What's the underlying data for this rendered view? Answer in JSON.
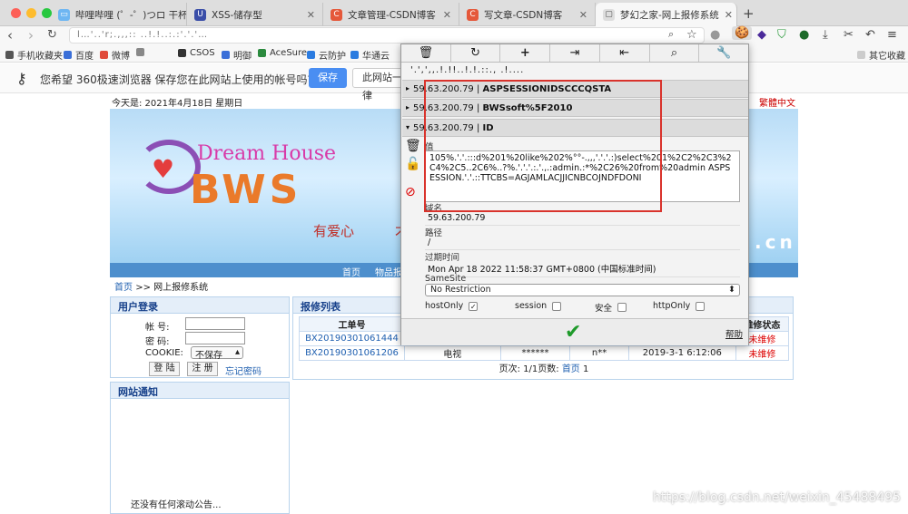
{
  "tabs": [
    {
      "title": "哔哩哔哩 (゜-゜)つロ 干杯~-…",
      "color": "#6eb6f2",
      "glyph": "▭"
    },
    {
      "title": "XSS-储存型",
      "color": "#3a4ea8",
      "glyph": "U"
    },
    {
      "title": "文章管理-CSDN博客",
      "color": "#e5583a",
      "glyph": "C"
    },
    {
      "title": "写文章-CSDN博客",
      "color": "#e5583a",
      "glyph": "C"
    },
    {
      "title": "梦幻之家-网上报修系统",
      "color": "#dddddd",
      "glyph": "▢"
    }
  ],
  "address": {
    "value": "l…'..'r;.,,,:: ..!.!..:.:'.'.'…"
  },
  "bookmarks": [
    {
      "label": "手机收藏夹",
      "color": "#555555"
    },
    {
      "label": "百度",
      "color": "#3a6fd8"
    },
    {
      "label": "微博",
      "color": "#e04a3a"
    },
    {
      "label": "",
      "color": "#888888"
    },
    {
      "label": "CSOS",
      "color": "#333333"
    },
    {
      "label": "明御",
      "color": "#3a6fd8"
    },
    {
      "label": "AceSure",
      "color": "#2b8a3e"
    },
    {
      "label": "云防护",
      "color": "#2a7be0"
    },
    {
      "label": "华通云",
      "color": "#2a7be0"
    }
  ],
  "bookmarks_other": "其它收藏",
  "notify": {
    "message": "您希望 360极速浏览器 保存您在此网站上使用的帐号吗?",
    "save": "保存",
    "deny": "此网站一律"
  },
  "site": {
    "date": "今天是: 2021年4月18日 星期日",
    "trad": "繁體中文",
    "logo_top": "Dream House",
    "logo_main": "BWS",
    "slogan": "有爱心",
    "slogan2": "才",
    "cn": ".cn",
    "menu": [
      "首页",
      "物品报"
    ],
    "crumb_home": "首页",
    "crumb_sep": ">>",
    "crumb_page": "网上报修系统",
    "login_title": "用户登录",
    "account_label": "帐  号:",
    "password_label": "密  码:",
    "cookie_label": "COOKIE:",
    "cookie_option": "不保存",
    "login_btn": "登 陆",
    "register_btn": "注 册",
    "forgot": "忘记密码",
    "notice_title": "网站通知",
    "notice_text": "还没有任何滚动公告...",
    "list_title": "报修列表",
    "table_headers": [
      "工单号",
      "维修状态"
    ],
    "rows": [
      {
        "id": "BX20190301061444",
        "item": "",
        "code": "",
        "user": "",
        "time": "",
        "status": "未维修"
      },
      {
        "id": "BX20190301061206",
        "item": "电视",
        "code": "******",
        "user": "n**",
        "time": "2019-3-1 6:12:06",
        "status": "未维修"
      }
    ],
    "pager_text": "页次: 1/1页数:",
    "pager_home": "首页",
    "pager_num": "1"
  },
  "cookie_editor": {
    "toolbar_icons": [
      "trash-icon",
      "refresh-icon",
      "plus-icon",
      "import-icon",
      "export-icon",
      "search-icon",
      "wrench-icon"
    ],
    "domain": "'.',',,.!.!!..!.!.::.,  .!....",
    "cookies": [
      {
        "host": "59.63.200.79",
        "name": "ASPSESSIONIDSCCCQSTA",
        "expanded": false
      },
      {
        "host": "59.63.200.79",
        "name": "BWSsoft%5F2010",
        "expanded": false
      },
      {
        "host": "59.63.200.79",
        "name": "ID",
        "expanded": true
      }
    ],
    "value_label": "值",
    "value": "105%.'.'.:::d%201%20like%202%°°-.,,,'.'.'.:)select%201%2C2%2C3%2C4%2C5..2C6%..?%.'.'.'.:.'.,.:admin.:*%2C26%20from%20admin ASPSESSION.'.'.::TTCBS=AGJAMLACJJICNBCOJNDFDONI",
    "domain_label": "域名",
    "domain_value": "59.63.200.79",
    "path_label": "路径",
    "path_value": "/",
    "expires_label": "过期时间",
    "expires_value": "Mon Apr 18 2022 11:58:37 GMT+0800 (中国标准时间)",
    "samesite_label": "SameSite",
    "samesite_value": "No Restriction",
    "hostonly_label": "hostOnly",
    "session_label": "session",
    "secure_label": "安全",
    "httponly_label": "httpOnly",
    "help": "帮助"
  },
  "watermark": "https://blog.csdn.net/weixin_45488495",
  "colors": {
    "accent": "#4a8ef2",
    "highlight": "#d9332c",
    "ok": "#1e9a2a"
  }
}
